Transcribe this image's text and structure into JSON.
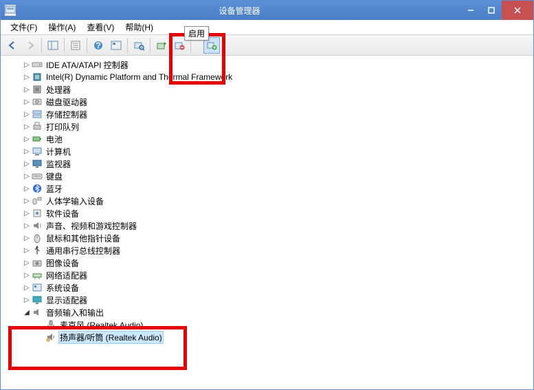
{
  "window": {
    "title": "设备管理器",
    "tooltip": "启用"
  },
  "menu": {
    "file": "文件(F)",
    "action": "操作(A)",
    "view": "查看(V)",
    "help": "帮助(H)"
  },
  "tree": {
    "items": [
      {
        "label": "IDE ATA/ATAPI 控制器",
        "icon": "drive-icon",
        "expander": "▷"
      },
      {
        "label": "Intel(R) Dynamic Platform and Thermal Framework",
        "icon": "chip-icon",
        "expander": "▷",
        "truncated": "Intel(R) Dynamic Platform and T"
      },
      {
        "label": "处理器",
        "icon": "cpu-icon",
        "expander": "▷"
      },
      {
        "label": "磁盘驱动器",
        "icon": "disk-icon",
        "expander": "▷"
      },
      {
        "label": "存储控制器",
        "icon": "storage-icon",
        "expander": "▷"
      },
      {
        "label": "打印队列",
        "icon": "printer-icon",
        "expander": "▷"
      },
      {
        "label": "电池",
        "icon": "battery-icon",
        "expander": "▷"
      },
      {
        "label": "计算机",
        "icon": "computer-icon",
        "expander": "▷"
      },
      {
        "label": "监视器",
        "icon": "monitor-icon",
        "expander": "▷"
      },
      {
        "label": "键盘",
        "icon": "keyboard-icon",
        "expander": "▷"
      },
      {
        "label": "蓝牙",
        "icon": "bluetooth-icon",
        "expander": "▷"
      },
      {
        "label": "人体学输入设备",
        "icon": "hid-icon",
        "expander": "▷"
      },
      {
        "label": "软件设备",
        "icon": "software-icon",
        "expander": "▷"
      },
      {
        "label": "声音、视频和游戏控制器",
        "icon": "sound-icon",
        "expander": "▷"
      },
      {
        "label": "鼠标和其他指针设备",
        "icon": "mouse-icon",
        "expander": "▷"
      },
      {
        "label": "通用串行总线控制器",
        "icon": "usb-icon",
        "expander": "▷"
      },
      {
        "label": "图像设备",
        "icon": "camera-icon",
        "expander": "▷"
      },
      {
        "label": "网络适配器",
        "icon": "network-icon",
        "expander": "▷"
      },
      {
        "label": "系统设备",
        "icon": "system-icon",
        "expander": "▷"
      },
      {
        "label": "显示适配器",
        "icon": "display-icon",
        "expander": "▷"
      },
      {
        "label": "音频输入和输出",
        "icon": "audio-icon",
        "expander": "◢",
        "children": [
          {
            "label": "麦克风 (Realtek Audio)",
            "icon": "mic-icon"
          },
          {
            "label": "扬声器/听筒 (Realtek Audio)",
            "icon": "speaker-icon",
            "selected": true
          }
        ]
      }
    ]
  }
}
